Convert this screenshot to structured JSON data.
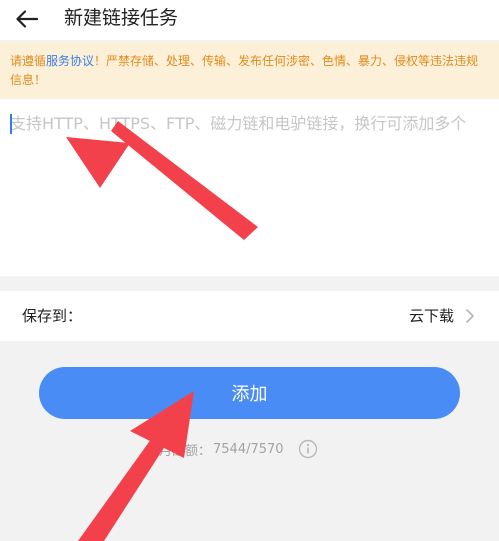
{
  "header": {
    "back_icon": "arrow-left-icon",
    "title": "新建链接任务"
  },
  "notice": {
    "prefix": "请遵循",
    "link_text": "服务协议",
    "suffix": "！严禁存储、处理、传输、发布任何涉密、色情、暴力、侵权等违法违规信息！",
    "text_color": "#e28a1c",
    "link_color": "#3a7fe6",
    "background": "#fdf0d9"
  },
  "link_input": {
    "value": "",
    "placeholder": "支持HTTP、HTTPS、FTP、磁力链和电驴链接，换行可添加多个"
  },
  "save_to": {
    "label": "保存到：",
    "value": "云下载",
    "chevron_icon": "chevron-right-icon"
  },
  "add_button": {
    "label": "添加",
    "color": "#4a8cf5"
  },
  "quota": {
    "label": "本月配额：",
    "value": "7544/7570",
    "info_icon": "info-icon"
  },
  "annotations": {
    "arrow_color": "#f2414b"
  }
}
